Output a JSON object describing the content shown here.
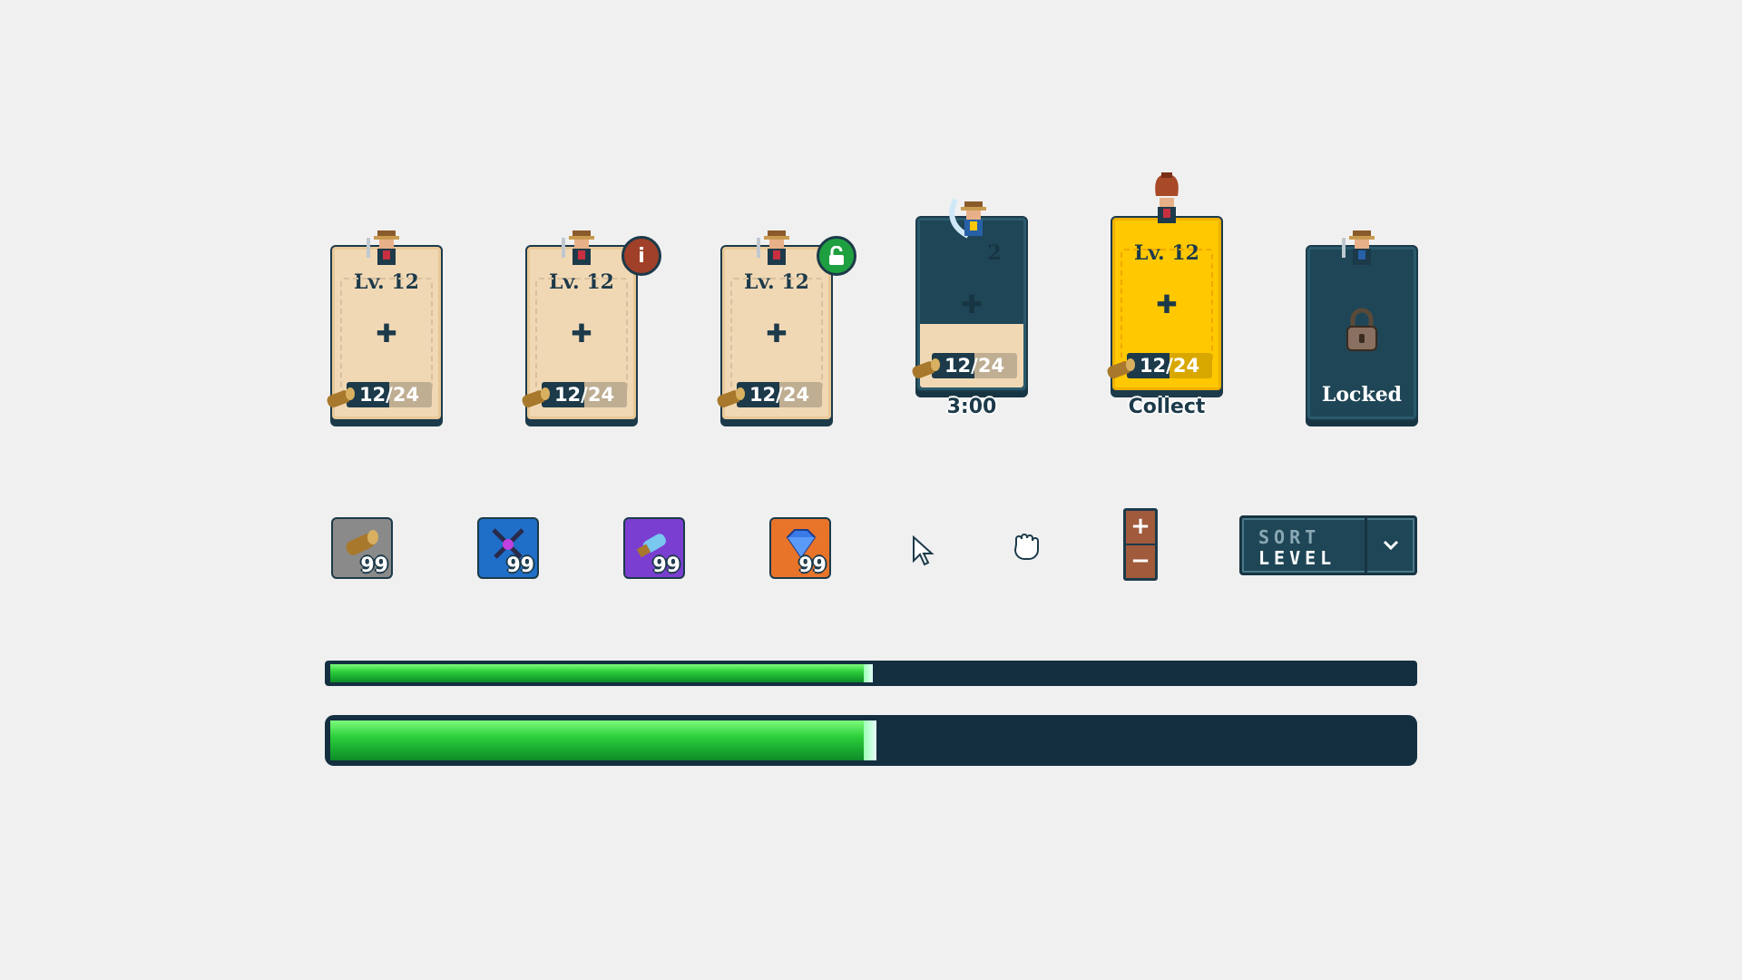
{
  "cards": [
    {
      "level": "Lv. 12",
      "xp": "12/24",
      "xp_progress": 0.5
    },
    {
      "level": "Lv. 12",
      "xp": "12/24",
      "xp_progress": 0.5,
      "badge": "i"
    },
    {
      "level": "Lv. 12",
      "xp": "12/24",
      "xp_progress": 0.5,
      "badge": "unlock-icon"
    },
    {
      "level": "2",
      "xp": "12/24",
      "xp_progress": 0.5,
      "timer": "3:00"
    },
    {
      "level": "Lv. 12",
      "xp": "12/24",
      "xp_progress": 0.5,
      "action": "Collect"
    },
    {
      "status": "Locked"
    }
  ],
  "items": [
    {
      "icon": "log-icon",
      "count": "99",
      "color": "#8a8a8a"
    },
    {
      "icon": "crossed-swords-icon",
      "count": "99",
      "color": "#1f6fc8"
    },
    {
      "icon": "scroll-icon",
      "count": "99",
      "color": "#7a3fd0"
    },
    {
      "icon": "diamond-icon",
      "count": "99",
      "color": "#e8742a"
    }
  ],
  "cursors": [
    "pointer-cursor-icon",
    "grab-cursor-icon"
  ],
  "stepper": {
    "plus": "+",
    "minus": "−"
  },
  "sort": {
    "label_line1": "SORT",
    "label_line2": "LEVEL"
  },
  "progress_bars": [
    {
      "progress": 0.5
    },
    {
      "progress": 0.5
    }
  ],
  "colors": {
    "navy": "#1c3a4a",
    "parchment": "#f1d8b4",
    "gold": "#ffc800",
    "green": "#2ecf3c"
  }
}
